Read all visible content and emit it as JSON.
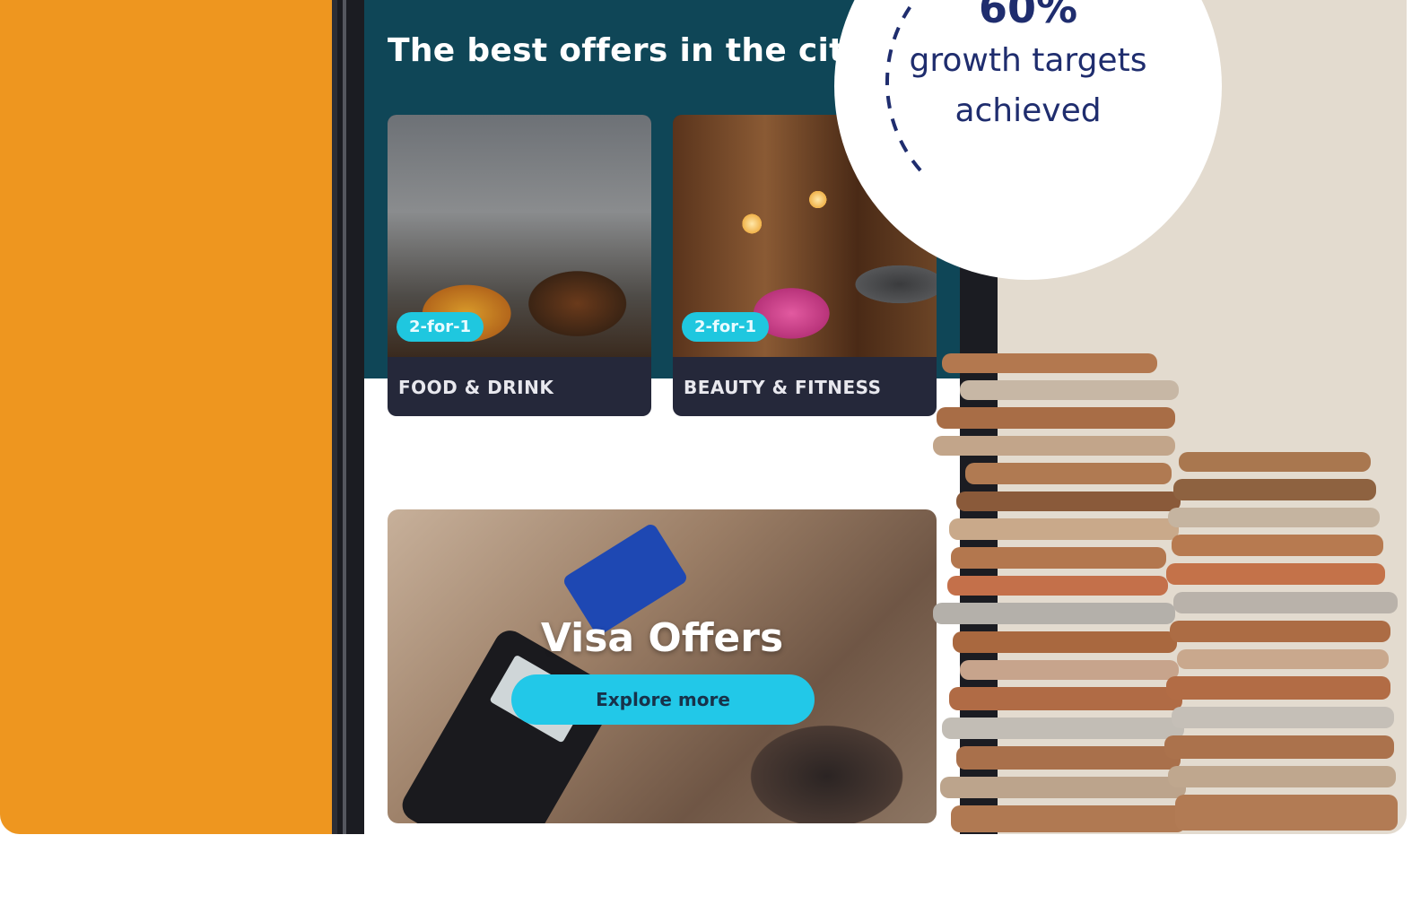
{
  "screen": {
    "title": "The best offers in the city",
    "cards": [
      {
        "label": "FOOD & DRINK",
        "badge": "2-for-1"
      },
      {
        "label": "BEAUTY & FITNESS",
        "badge": "2-for-1"
      }
    ],
    "promo": {
      "title": "Visa Offers",
      "button_label": "Explore more"
    }
  },
  "stat": {
    "value": "60%",
    "caption": "growth targets achieved"
  },
  "colors": {
    "orange_panel": "#ee961f",
    "screen_header": "#0f4657",
    "accent_cyan": "#22c8e8",
    "stat_text": "#1f2d6e",
    "background": "#e3dbcf"
  }
}
